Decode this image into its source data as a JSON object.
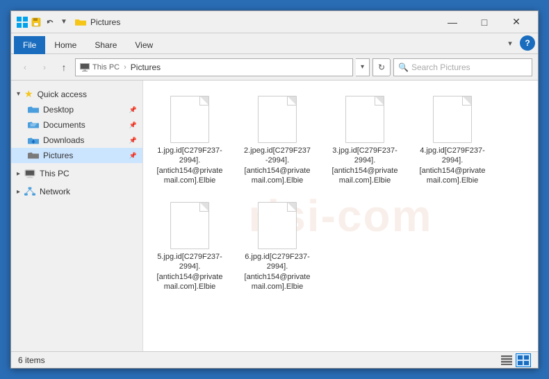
{
  "window": {
    "title": "Pictures",
    "controls": {
      "minimize": "—",
      "maximize": "□",
      "close": "✕"
    }
  },
  "ribbon": {
    "tabs": [
      "File",
      "Home",
      "Share",
      "View"
    ],
    "active_tab": "File"
  },
  "address_bar": {
    "back": "‹",
    "forward": "›",
    "up": "↑",
    "crumbs": [
      "This PC",
      "Pictures"
    ],
    "crumb_sep": "›",
    "refresh": "↻",
    "search_placeholder": "Search Pictures"
  },
  "sidebar": {
    "quick_access_label": "Quick access",
    "items": [
      {
        "id": "desktop",
        "label": "Desktop",
        "pinned": true
      },
      {
        "id": "documents",
        "label": "Documents",
        "pinned": true
      },
      {
        "id": "downloads",
        "label": "Downloads",
        "pinned": true
      },
      {
        "id": "pictures",
        "label": "Pictures",
        "pinned": true,
        "active": true
      }
    ],
    "this_pc_label": "This PC",
    "network_label": "Network"
  },
  "files": [
    {
      "row": 1,
      "items": [
        {
          "id": "f1",
          "name": "1.jpg.id[C279F237-2994].[antich154@privatemail.com].Elbie"
        },
        {
          "id": "f2",
          "name": "2.jpeg.id[C279F237-2994].[antich154@privatemail.com].Elbie"
        },
        {
          "id": "f3",
          "name": "3.jpg.id[C279F237-2994].[antich154@privatemail.com].Elbie"
        },
        {
          "id": "f4",
          "name": "4.jpg.id[C279F237-2994].[antich154@privatemail.com].Elbie"
        }
      ]
    },
    {
      "row": 2,
      "items": [
        {
          "id": "f5",
          "name": "5.jpg.id[C279F237-2994].[antich154@privatemail.com].Elbie"
        },
        {
          "id": "f6",
          "name": "6.jpg.id[C279F237-2994].[antich154@privatemail.com].Elbie"
        }
      ]
    }
  ],
  "status_bar": {
    "item_count": "6 items"
  },
  "watermark": "risi-com",
  "colors": {
    "accent": "#1a6dbe",
    "folder_blue": "#4a9edd",
    "active_tab_bg": "#ffffff",
    "sidebar_active": "#cce5ff"
  }
}
